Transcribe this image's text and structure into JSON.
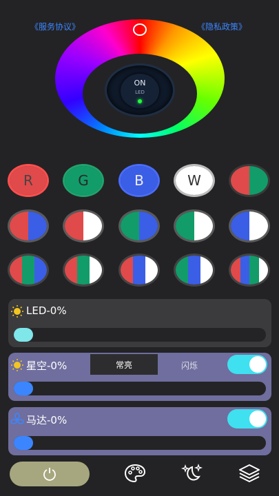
{
  "links": {
    "terms": "《服务协议》",
    "privacy": "《隐私政策》"
  },
  "power": {
    "state": "ON",
    "label": "LED"
  },
  "color_buttons": {
    "row1": [
      {
        "label": "R",
        "bg": [
          "#e04a4a"
        ],
        "text": "#444",
        "ring": "#ff4f4f"
      },
      {
        "label": "G",
        "bg": [
          "#129c6a"
        ],
        "text": "#2a2a2a",
        "ring": "#20a36c"
      },
      {
        "label": "B",
        "bg": [
          "#3b5ee6"
        ],
        "text": "#eee",
        "ring": "#4a6cff"
      },
      {
        "label": "W",
        "bg": [
          "#ffffff"
        ],
        "text": "#333",
        "ring": "#bbbbbb"
      },
      {
        "label": "",
        "bg": [
          "#e04a4a",
          "#129c6a"
        ],
        "text": "#fff",
        "ring": "#3a3a3a"
      }
    ],
    "row2": [
      {
        "label": "",
        "bg": [
          "#e04a4a",
          "#3b5ee6"
        ],
        "text": "#fff",
        "ring": "#5a5a5a"
      },
      {
        "label": "",
        "bg": [
          "#e04a4a",
          "#ffffff"
        ],
        "text": "#fff",
        "ring": "#5a5a5a"
      },
      {
        "label": "",
        "bg": [
          "#129c6a",
          "#3b5ee6"
        ],
        "text": "#fff",
        "ring": "#5a5a5a"
      },
      {
        "label": "",
        "bg": [
          "#129c6a",
          "#ffffff"
        ],
        "text": "#fff",
        "ring": "#5a5a5a"
      },
      {
        "label": "",
        "bg": [
          "#3b5ee6",
          "#ffffff"
        ],
        "text": "#fff",
        "ring": "#5a5a5a"
      }
    ],
    "row3": [
      {
        "label": "",
        "bg": [
          "#e04a4a",
          "#129c6a",
          "#3b5ee6"
        ],
        "text": "#fff",
        "ring": "#444"
      },
      {
        "label": "",
        "bg": [
          "#e04a4a",
          "#129c6a",
          "#ffffff"
        ],
        "text": "#fff",
        "ring": "#444"
      },
      {
        "label": "",
        "bg": [
          "#e04a4a",
          "#3b5ee6",
          "#ffffff"
        ],
        "text": "#fff",
        "ring": "#444"
      },
      {
        "label": "",
        "bg": [
          "#129c6a",
          "#3b5ee6",
          "#ffffff"
        ],
        "text": "#fff",
        "ring": "#444"
      },
      {
        "label": "",
        "bg": [
          "#e04a4a",
          "#3b5ee6",
          "#129c6a",
          "#ffffff"
        ],
        "text": "#fff",
        "ring": "#444"
      }
    ]
  },
  "panels": {
    "led": {
      "title": "LED-0%",
      "value_percent": 0,
      "thumb_color": "#7fe6ea"
    },
    "star": {
      "title": "星空-0%",
      "value_percent": 0,
      "thumb_color": "#3b86ff",
      "mode_selected": "常亮",
      "mode_other": "闪烁",
      "toggle_on": true
    },
    "motor": {
      "title": "马达-0%",
      "value_percent": 0,
      "thumb_color": "#3b86ff",
      "toggle_on": true
    }
  },
  "nav": {
    "icons": [
      "power-icon",
      "palette-icon",
      "moon-stars-icon",
      "layers-icon"
    ]
  },
  "colors": {
    "accent": "#3fe0f0",
    "link": "#3b86ff",
    "panel": "#6f6e9e"
  }
}
